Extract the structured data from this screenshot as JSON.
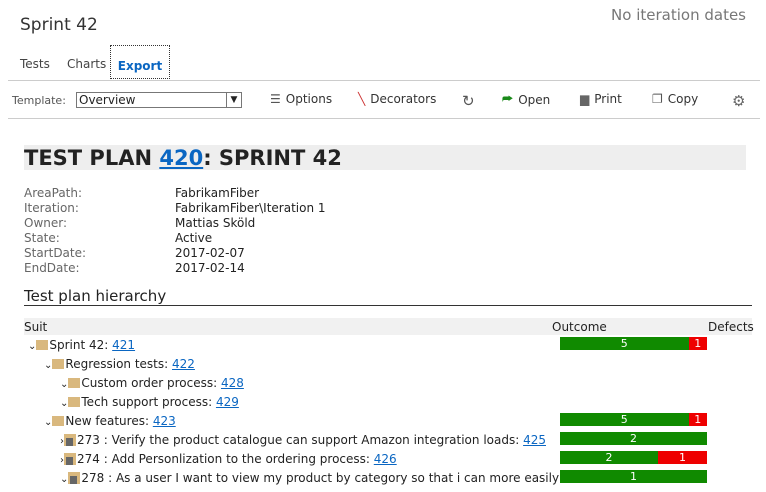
{
  "header": {
    "title": "Sprint 42",
    "dates": "No iteration dates"
  },
  "tabs": [
    "Tests",
    "Charts",
    "Export"
  ],
  "toolbar": {
    "template_label": "Template:",
    "template_value": "Overview",
    "options": "Options",
    "decorators": "Decorators",
    "open": "Open",
    "print": "Print",
    "copy": "Copy"
  },
  "plan": {
    "title_prefix": "TEST PLAN ",
    "id": "420",
    "title_suffix": ": SPRINT 42"
  },
  "props": [
    [
      "AreaPath:",
      "FabrikamFiber"
    ],
    [
      "Iteration:",
      "FabrikamFiber\\Iteration 1"
    ],
    [
      "Owner:",
      "Mattias Sköld"
    ],
    [
      "State:",
      "Active"
    ],
    [
      "StartDate:",
      "2017-02-07"
    ],
    [
      "EndDate:",
      "2017-02-14"
    ]
  ],
  "hierarchy": {
    "heading": "Test plan hierarchy",
    "columns": [
      "Suit",
      "Outcome",
      "Defects"
    ],
    "rows": [
      {
        "label": "Sprint 42: ",
        "id": "421",
        "passed": 5,
        "failed": 1
      },
      {
        "label": "Regression tests: ",
        "id": "422"
      },
      {
        "label": "Custom order process: ",
        "id": "428"
      },
      {
        "label": "Tech support process: ",
        "id": "429"
      },
      {
        "label": "New features: ",
        "id": "423",
        "passed": 5,
        "failed": 1
      },
      {
        "label": "273 : Verify the product catalogue can support Amazon integration loads: ",
        "id": "425",
        "passed": 2,
        "failed": 0
      },
      {
        "label": "274 : Add Personlization to the ordering process: ",
        "id": "426",
        "passed": 2,
        "failed": 1
      },
      {
        "label": "278 : As a user I want to view my product by category so that i can more easily",
        "passed": 1,
        "failed": 0
      }
    ]
  },
  "colors": {
    "pass": "#108a00",
    "fail": "#e00000",
    "link": "#0a66c2"
  }
}
